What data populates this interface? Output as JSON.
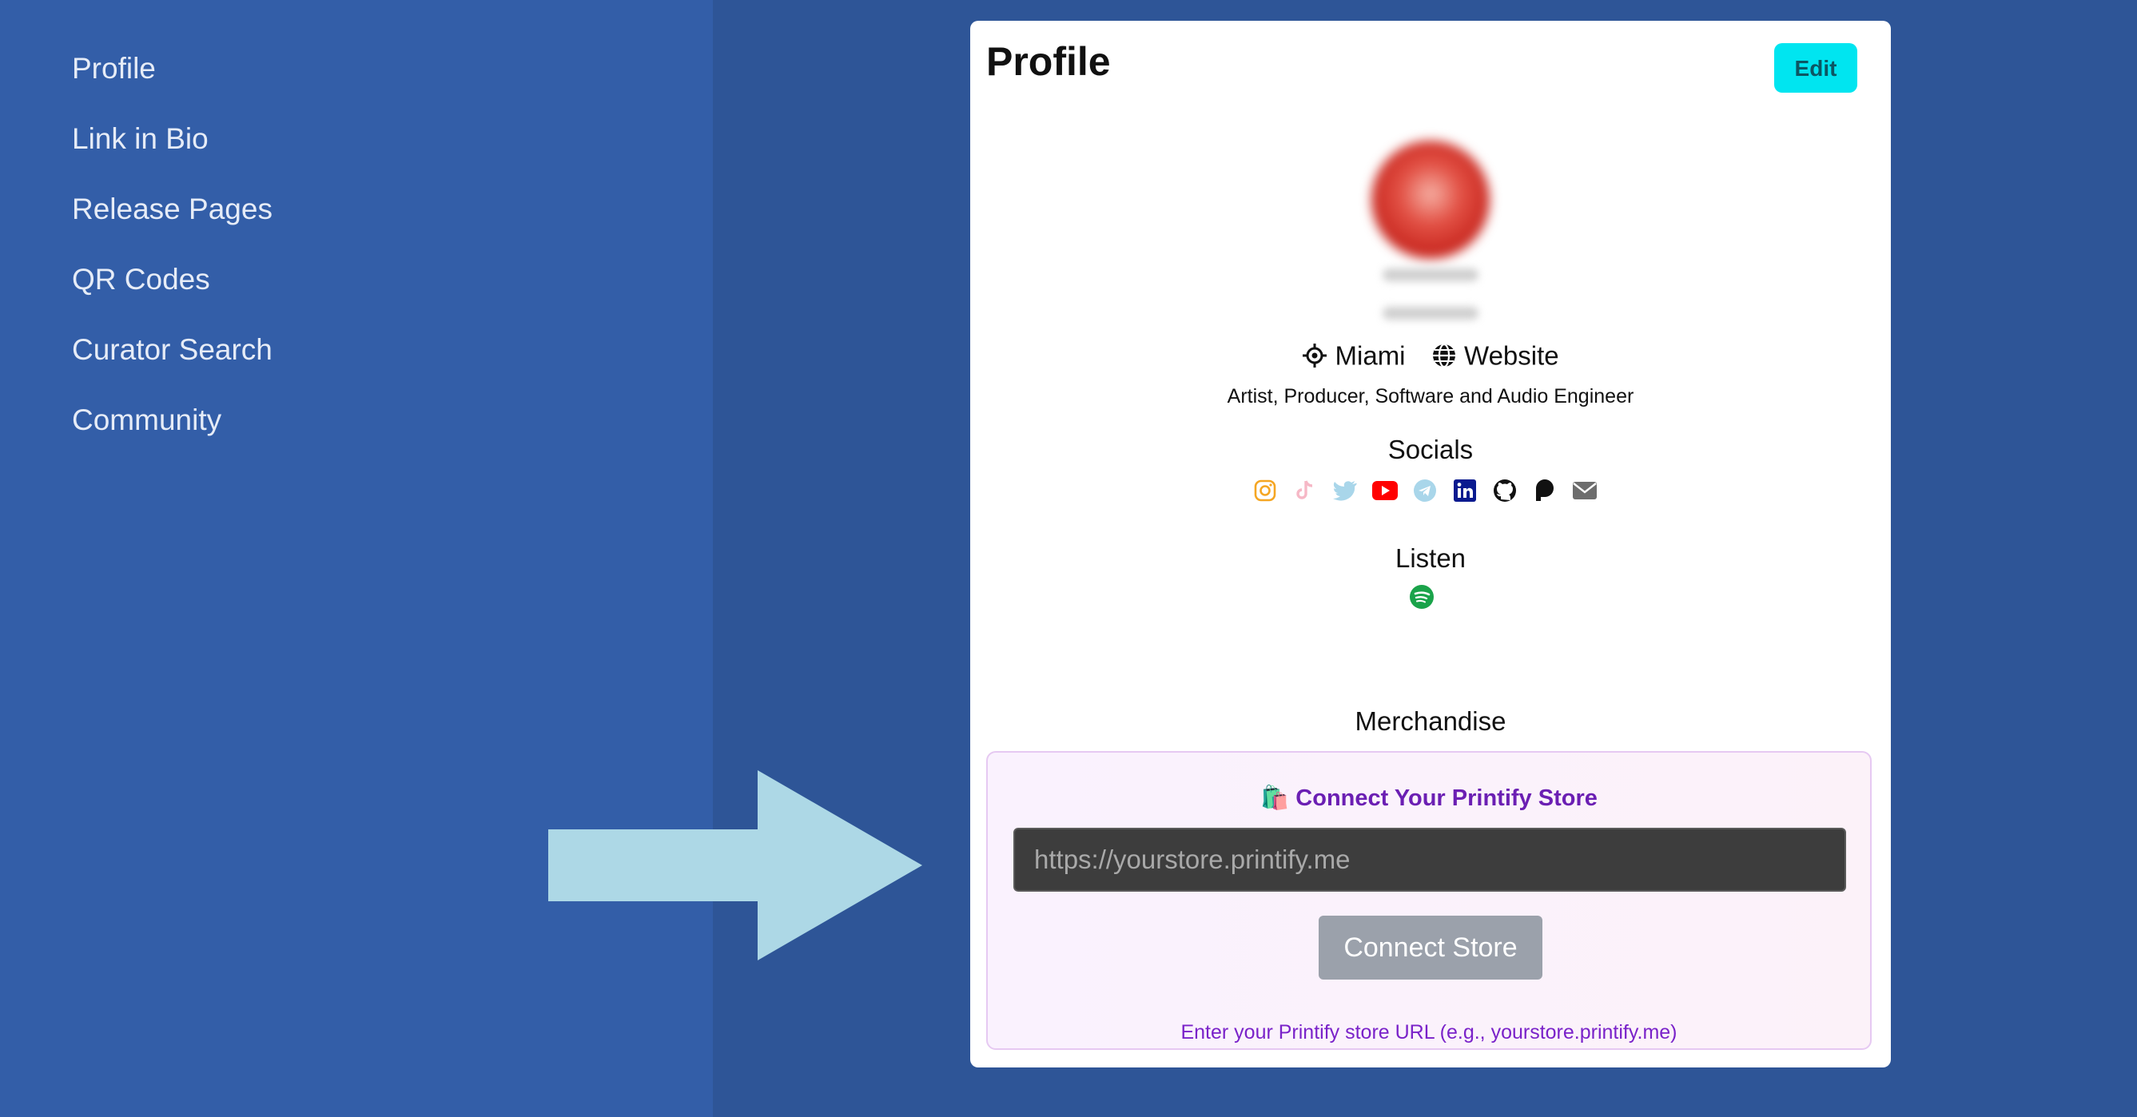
{
  "sidebar": {
    "items": [
      {
        "label": "Profile"
      },
      {
        "label": "Link in Bio"
      },
      {
        "label": "Release Pages"
      },
      {
        "label": "QR Codes"
      },
      {
        "label": "Curator Search"
      },
      {
        "label": "Community"
      }
    ]
  },
  "profile": {
    "title": "Profile",
    "edit_label": "Edit",
    "location": "Miami",
    "website_label": "Website",
    "bio": "Artist, Producer, Software and Audio Engineer",
    "socials_heading": "Socials",
    "socials": [
      {
        "icon": "instagram-icon",
        "color": "#f5a623"
      },
      {
        "icon": "tiktok-icon",
        "color": "#f6b8c6"
      },
      {
        "icon": "twitter-icon",
        "color": "#a9d6ea"
      },
      {
        "icon": "youtube-icon",
        "color": "#ff0000"
      },
      {
        "icon": "telegram-icon",
        "color": "#a9d6ea"
      },
      {
        "icon": "linkedin-icon",
        "color": "#0a1a8f"
      },
      {
        "icon": "github-icon",
        "color": "#111111"
      },
      {
        "icon": "patreon-icon",
        "color": "#111111"
      },
      {
        "icon": "email-icon",
        "color": "#6d6d6d"
      }
    ],
    "listen_heading": "Listen",
    "listen": [
      {
        "icon": "spotify-icon",
        "color": "#1aa34a"
      }
    ],
    "merch_heading": "Merchandise",
    "merch": {
      "title_emoji": "🛍️",
      "title": "Connect Your Printify Store",
      "input_value": "",
      "input_placeholder": "https://yourstore.printify.me",
      "connect_label": "Connect Store",
      "hint": "Enter your Printify store URL (e.g., yourstore.printify.me)"
    }
  },
  "colors": {
    "sidebar_bg": "#335ea8",
    "main_bg": "#2e5597",
    "edit_button": "#00e5f0",
    "arrow": "#add8e6",
    "merch_accent": "#6b1fb3"
  }
}
